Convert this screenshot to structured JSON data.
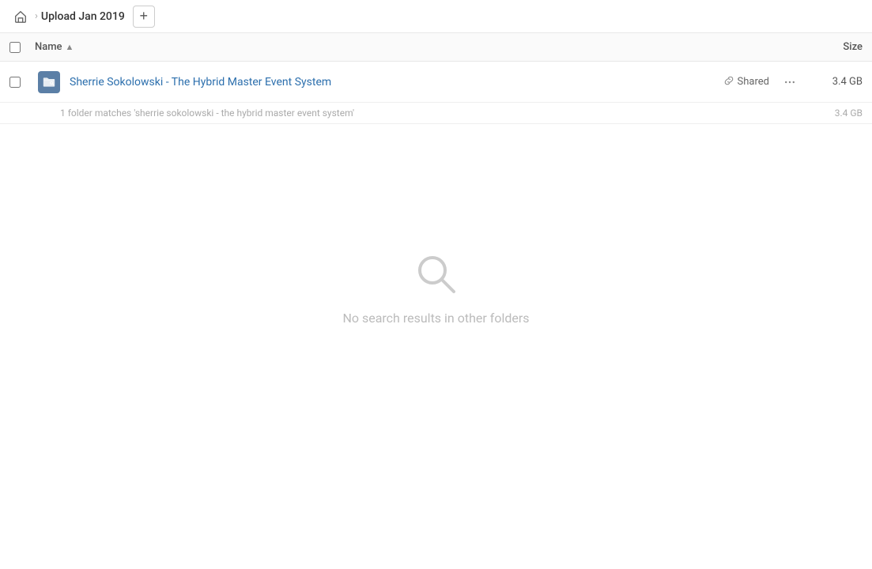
{
  "header": {
    "home_icon": "home-icon",
    "breadcrumb_title": "Upload Jan 2019",
    "add_button_label": "+"
  },
  "columns": {
    "name_label": "Name",
    "sort_arrow": "▲",
    "size_label": "Size"
  },
  "file_row": {
    "name": "Sherrie Sokolowski - The Hybrid Master Event System",
    "shared_label": "Shared",
    "size": "3.4 GB"
  },
  "summary": {
    "text": "1 folder matches 'sherrie sokolowski - the hybrid master event system'",
    "size": "3.4 GB"
  },
  "no_results": {
    "message": "No search results in other folders"
  },
  "icons": {
    "home": "⌂",
    "link": "🔗",
    "more": "•••",
    "folder_symbol": "🔗"
  }
}
